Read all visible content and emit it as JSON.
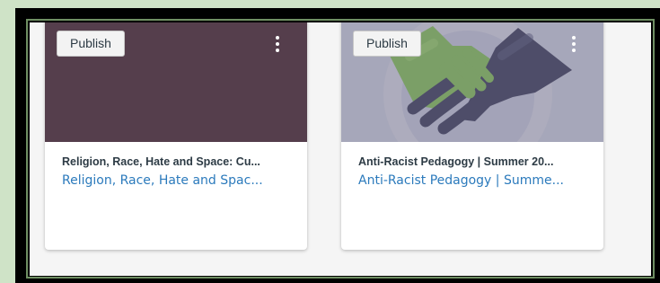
{
  "colors": {
    "page_background": "#cfe3c7",
    "frame": "#000000",
    "card_1_hero": "#553e4c",
    "card_2_hero": "#aeb4c4",
    "title_text": "#2d3b45",
    "link_text": "#2b7abc"
  },
  "cards": [
    {
      "publish_label": "Publish",
      "title": "Religion, Race, Hate and Space: Cu...",
      "link": "Religion, Race, Hate and Spac...",
      "menu_icon": "kebab-vertical-icon"
    },
    {
      "publish_label": "Publish",
      "title": "Anti-Racist Pedagogy | Summer 20...",
      "link": "Anti-Racist Pedagogy | Summe...",
      "menu_icon": "kebab-vertical-icon",
      "hero_image": "handshake-image"
    }
  ]
}
